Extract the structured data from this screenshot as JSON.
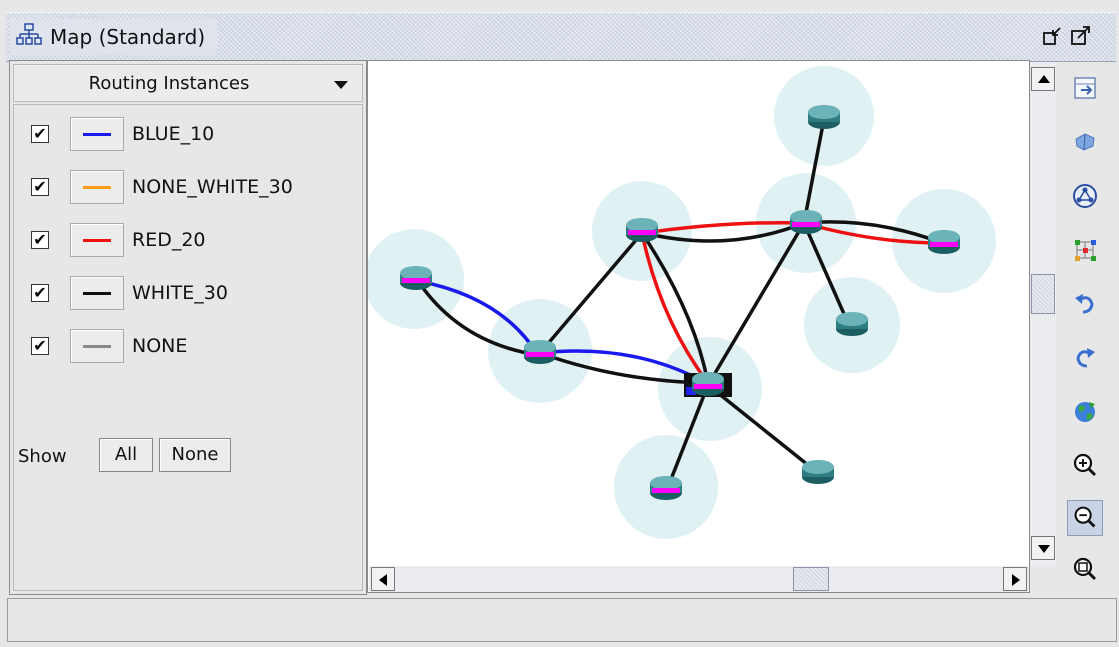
{
  "window": {
    "title": "Map (Standard)",
    "icon": "network-map-icon"
  },
  "left_panel": {
    "selector_label": "Routing Instances",
    "legend": [
      {
        "label": "BLUE_10",
        "color": "#1a1aee",
        "checked": true
      },
      {
        "label": "NONE_WHITE_30",
        "color": "#ff9a1a",
        "checked": true
      },
      {
        "label": "RED_20",
        "color": "#ee1111",
        "checked": true
      },
      {
        "label": "WHITE_30",
        "color": "#111111",
        "checked": true
      },
      {
        "label": "NONE",
        "color": "#888888",
        "checked": true
      }
    ],
    "show_label": "Show",
    "all_button": "All",
    "none_button": "None"
  },
  "toolbar": {
    "tools": [
      "fit-to-window-icon",
      "select-icon",
      "layout-icon",
      "grid-layout-icon",
      "undo-icon",
      "redo-icon",
      "refresh-globe-icon",
      "zoom-in-icon",
      "zoom-out-icon",
      "zoom-fit-icon"
    ]
  },
  "colors": {
    "router_body": "#3a8a8e",
    "router_highlight": "#ff00ff",
    "halo": "#dff1f3",
    "accent": "#1a1aee"
  }
}
